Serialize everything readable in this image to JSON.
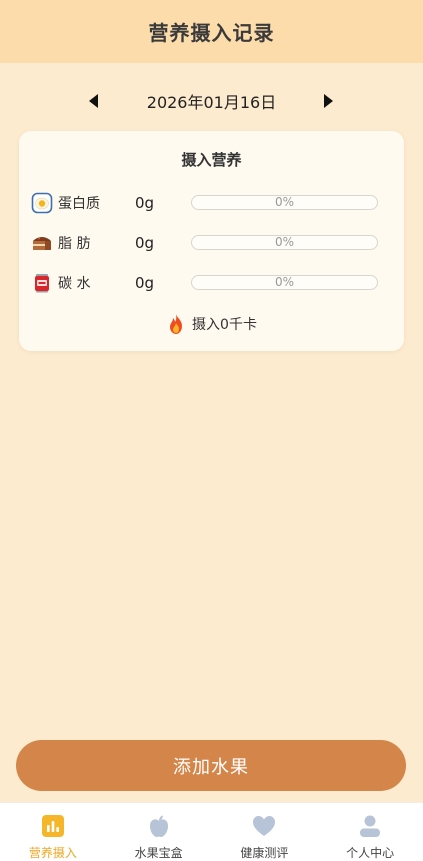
{
  "header": {
    "title": "营养摄入记录"
  },
  "date_nav": {
    "date": "2026年01月16日",
    "prev_icon": "triangle-left-icon",
    "next_icon": "triangle-right-icon"
  },
  "card": {
    "title": "摄入营养",
    "nutrients": [
      {
        "label": "蛋白质",
        "value": "0g",
        "percent_text": "0%",
        "fraction": 0,
        "icon": "fried-egg-icon"
      },
      {
        "label": "脂 肪",
        "value": "0g",
        "percent_text": "0%",
        "fraction": 0,
        "icon": "cake-icon"
      },
      {
        "label": "碳 水",
        "value": "0g",
        "percent_text": "0%",
        "fraction": 0,
        "icon": "can-icon"
      }
    ],
    "kcal": {
      "text": "摄入0千卡",
      "icon": "fire-icon"
    }
  },
  "add_button": {
    "label": "添加水果"
  },
  "tabbar": {
    "active_color": "#f0a622",
    "items": [
      {
        "label": "营养摄入",
        "icon": "bar-chart-icon",
        "active": true
      },
      {
        "label": "水果宝盒",
        "icon": "apple-icon",
        "active": false
      },
      {
        "label": "健康测评",
        "icon": "heart-icon",
        "active": false
      },
      {
        "label": "个人中心",
        "icon": "user-icon",
        "active": false
      }
    ]
  },
  "colors": {
    "header_bg": "#fbdcaa",
    "page_bg": "#fdebd0",
    "button_bg": "#d4854a"
  }
}
